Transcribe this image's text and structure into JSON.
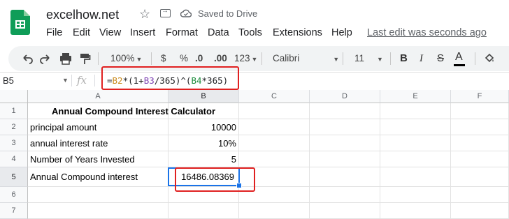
{
  "header": {
    "title": "excelhow.net",
    "saved_status": "Saved to Drive",
    "last_edit": "Last edit was seconds ago",
    "menu": [
      "File",
      "Edit",
      "View",
      "Insert",
      "Format",
      "Data",
      "Tools",
      "Extensions",
      "Help"
    ]
  },
  "toolbar": {
    "zoom": "100%",
    "currency": "$",
    "percent": "%",
    "decrease_decimal": ".0",
    "increase_decimal": ".00",
    "more_formats": "123",
    "font": "Calibri",
    "font_size": "11",
    "bold": "B",
    "italic": "I",
    "text_color": "A",
    "text_color_value": "#000000"
  },
  "formula_bar": {
    "name_box": "B5",
    "fx": "fx",
    "formula_parts": [
      "=",
      "B2",
      "*(1+",
      "B3",
      "/365)^(",
      "B4",
      "*365)"
    ]
  },
  "grid": {
    "columns": [
      "A",
      "B",
      "C",
      "D",
      "E",
      "F"
    ],
    "rows": [
      "1",
      "2",
      "3",
      "4",
      "5",
      "6",
      "7"
    ],
    "cells": {
      "A1": "Annual Compound Interest Calculator",
      "A2": "principal amount",
      "B2": "10000",
      "A3": "annual interest rate",
      "B3": "10%",
      "A4": "Number of Years Invested",
      "B4": "5",
      "A5": "Annual Compound interest",
      "B5": "16486.08369"
    },
    "selected_cell": "B5"
  },
  "colors": {
    "highlight_border": "#e02020",
    "selection": "#1a73e8",
    "logo": "#0f9d58"
  }
}
